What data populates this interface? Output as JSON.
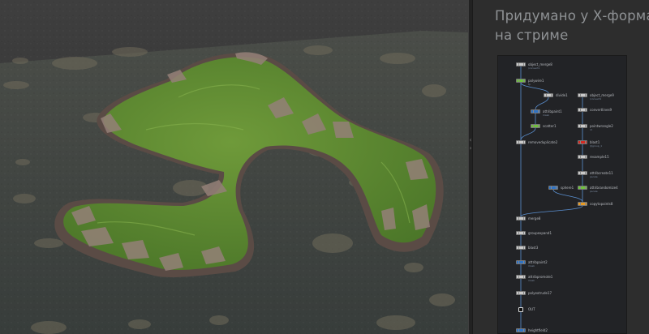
{
  "caption": {
    "line1": "Придумано у Х-форма",
    "line2": "на стриме"
  },
  "colors": {
    "ocean": "#3c4240",
    "grass": "#5f8a32",
    "rock": "#8a7a72",
    "node_default": "#c9c9c9",
    "node_green": "#6fc13d",
    "node_blue": "#2f73c4",
    "node_red": "#d62a22",
    "node_orange": "#e89a21",
    "wire": "#5a8fd0"
  },
  "network": {
    "nodes": [
      {
        "id": "object_merge8",
        "label": "object_merge8",
        "sub": "/convert1",
        "color": "default"
      },
      {
        "id": "polywire1",
        "label": "polywire1",
        "sub": "tp",
        "color": "green"
      },
      {
        "id": "divide1",
        "label": "divide1",
        "sub": "",
        "color": "default"
      },
      {
        "id": "object_merge9",
        "label": "object_merge9",
        "sub": "/convert1",
        "color": "default"
      },
      {
        "id": "attribpaint1",
        "label": "attribpaint1",
        "sub": "mask",
        "color": "blue"
      },
      {
        "id": "convertlines9",
        "label": "convertlines9",
        "sub": "",
        "color": "default"
      },
      {
        "id": "scatter1",
        "label": "scatter1",
        "sub": "",
        "color": "green"
      },
      {
        "id": "pointwrangle2",
        "label": "pointwrangle2",
        "sub": "id",
        "color": "default"
      },
      {
        "id": "removeduplicate2",
        "label": "removeduplicate2",
        "sub": "",
        "color": "default"
      },
      {
        "id": "blast1",
        "label": "blast1",
        "sub": "@group_1",
        "color": "red"
      },
      {
        "id": "resample15",
        "label": "resample15",
        "sub": "",
        "color": "default"
      },
      {
        "id": "attribcreate11",
        "label": "attribcreate11",
        "sub": "pscale",
        "color": "default"
      },
      {
        "id": "sphere1",
        "label": "sphere1",
        "sub": "",
        "color": "blue"
      },
      {
        "id": "attribrandomize4",
        "label": "attribrandomize4",
        "sub": "pscale",
        "color": "green"
      },
      {
        "id": "copytopoints8",
        "label": "copytopoints8",
        "sub": "",
        "color": "orange"
      },
      {
        "id": "merge8",
        "label": "merge8",
        "sub": "",
        "color": "default"
      },
      {
        "id": "groupexpand1",
        "label": "groupexpand1",
        "sub": "",
        "color": "default"
      },
      {
        "id": "blast3",
        "label": "blast3",
        "sub": "",
        "color": "default"
      },
      {
        "id": "attribpaint2",
        "label": "attribpaint2",
        "sub": "mask",
        "color": "blue"
      },
      {
        "id": "attribpromote1",
        "label": "attribpromote1",
        "sub": "mask",
        "color": "default"
      },
      {
        "id": "polyextrude17",
        "label": "polyextrude17",
        "sub": "",
        "color": "default"
      },
      {
        "id": "OUT",
        "label": "OUT",
        "sub": "",
        "color": "default"
      },
      {
        "id": "heightfield2",
        "label": "heightfield2",
        "sub": "",
        "color": "blue"
      }
    ]
  }
}
